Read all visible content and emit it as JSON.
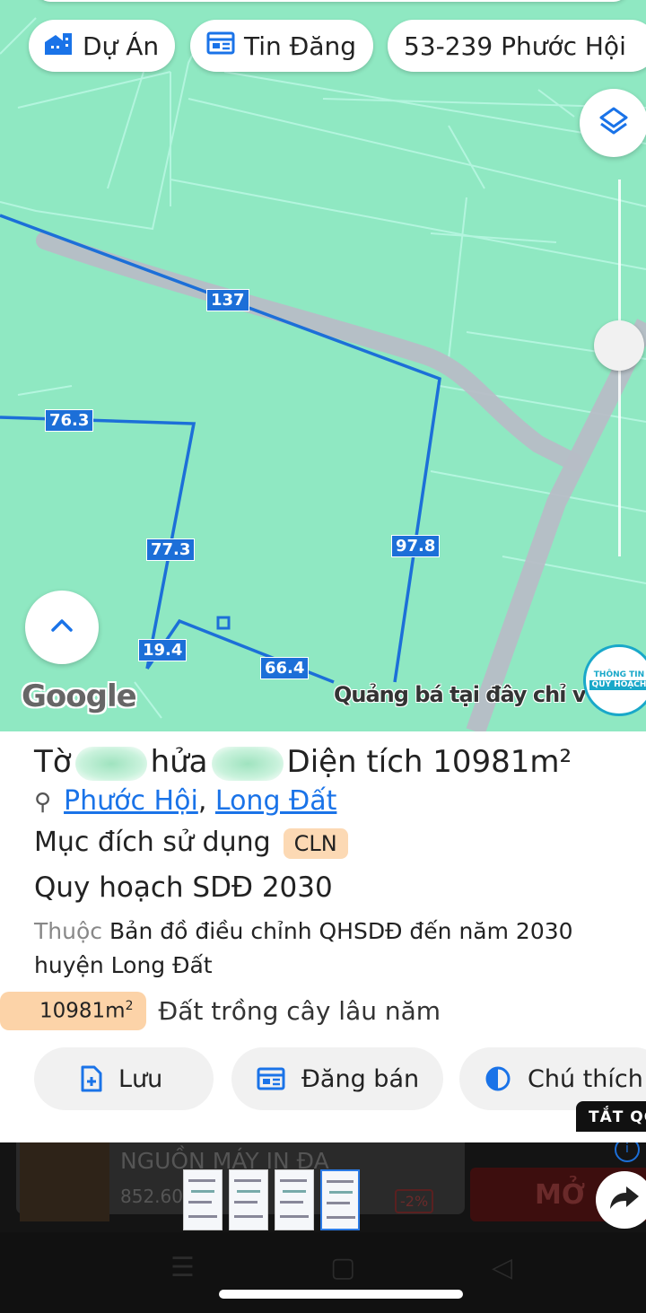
{
  "chips": {
    "du_an": "Dự Án",
    "tin_dang": "Tin Đăng",
    "address": "53-239 Phước Hội"
  },
  "map": {
    "segments": [
      "137",
      "76.3",
      "77.3",
      "97.8",
      "19.4",
      "66.4"
    ],
    "google": "Google",
    "ad_notice": "Quảng bá tại đây chỉ vớ",
    "badge_line1": "THÔNG TIN",
    "badge_line2": "QUY HOẠCH",
    "colors": {
      "map_bg": "#8fe8c2",
      "parcel_line": "#1c6fd8",
      "road": "#b7bdc6"
    }
  },
  "parcel": {
    "title_to": "Tờ",
    "title_thua": "hửa",
    "title_area": "Diện tích 10981m²",
    "location_1": "Phước Hội",
    "location_2": "Long Đất",
    "purpose_label": "Mục đích sử dụng",
    "purpose_code": "CLN",
    "plan_title": "Quy hoạch SDĐ 2030",
    "belong_prefix": "Thuộc",
    "belong_text": "Bản đồ điều chỉnh QHSDĐ đến năm 2030 huyện Long Đất",
    "area_value": "10981m",
    "area_sup": "2",
    "area_desc": "Đất trồng cây lâu năm"
  },
  "actions": {
    "save": "Lưu",
    "sell": "Đăng bán",
    "legend": "Chú thích"
  },
  "ad": {
    "hide": "TẮT QC",
    "title": "NGUỒN MÁY IN ĐA",
    "price": "852.60",
    "discount": "-2%",
    "open": "MỞ",
    "info": "i"
  }
}
